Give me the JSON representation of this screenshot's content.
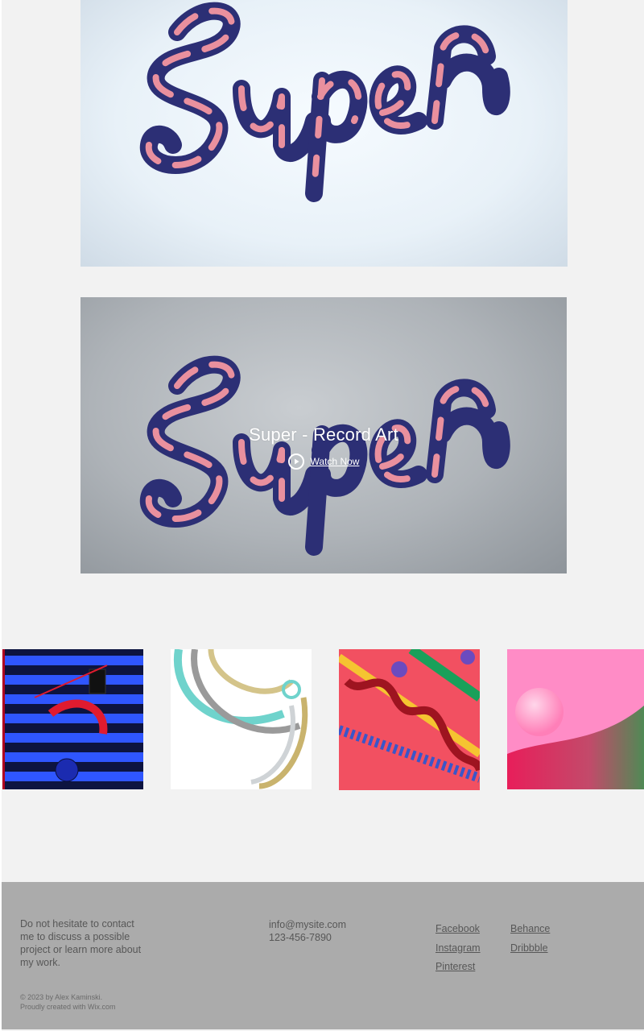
{
  "video": {
    "title": "Super - Record Art",
    "watch_label": "Watch Now"
  },
  "artwork": {
    "text": "Super"
  },
  "gallery": [
    {
      "name": "gallery-item-blue-stripes"
    },
    {
      "name": "gallery-item-metal-rings"
    },
    {
      "name": "gallery-item-red-candy"
    },
    {
      "name": "gallery-item-pink-sphere"
    }
  ],
  "footer": {
    "blurb": "Do not hesitate to contact me to discuss a possible project or learn more about my work.",
    "copyright": "© 2023 by Alex Kaminski.",
    "credit": "Proudly created with Wix.com",
    "email": "info@mysite.com",
    "phone": "123-456-7890",
    "social_col1": [
      "Facebook",
      "Instagram",
      "Pinterest"
    ],
    "social_col2": [
      "Behance",
      "Dribbble"
    ]
  },
  "colors": {
    "page_bg": "#f2f2f2",
    "footer_bg": "#ababab",
    "tube_navy": "#2c2f75",
    "tube_pink": "#e9909e"
  }
}
